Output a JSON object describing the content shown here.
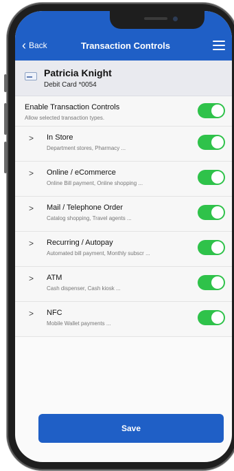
{
  "nav": {
    "back_label": "Back",
    "title": "Transaction Controls",
    "menu_icon": "hamburger-menu-icon"
  },
  "card": {
    "icon": "credit-card-icon",
    "holder_name": "Patricia Knight",
    "label": "Debit Card *0054"
  },
  "enable": {
    "title": "Enable Transaction Controls",
    "subtitle": "Allow selected transaction types.",
    "enabled": true
  },
  "categories": [
    {
      "title": "In Store",
      "subtitle": "Department stores, Pharmacy ...",
      "enabled": true
    },
    {
      "title": "Online / eCommerce",
      "subtitle": "Online Bill payment, Online shopping ...",
      "enabled": true
    },
    {
      "title": "Mail / Telephone Order",
      "subtitle": "Catalog shopping, Travel agents ...",
      "enabled": true
    },
    {
      "title": "Recurring / Autopay",
      "subtitle": "Automated bill payment, Monthly subscr ...",
      "enabled": true
    },
    {
      "title": "ATM",
      "subtitle": "Cash dispenser, Cash kiosk ...",
      "enabled": true
    },
    {
      "title": "NFC",
      "subtitle": "Mobile Wallet payments ...",
      "enabled": true
    }
  ],
  "save_label": "Save",
  "colors": {
    "primary": "#1f5fc6",
    "toggle_on": "#2fc24a",
    "header_bg": "#e9eaef"
  }
}
